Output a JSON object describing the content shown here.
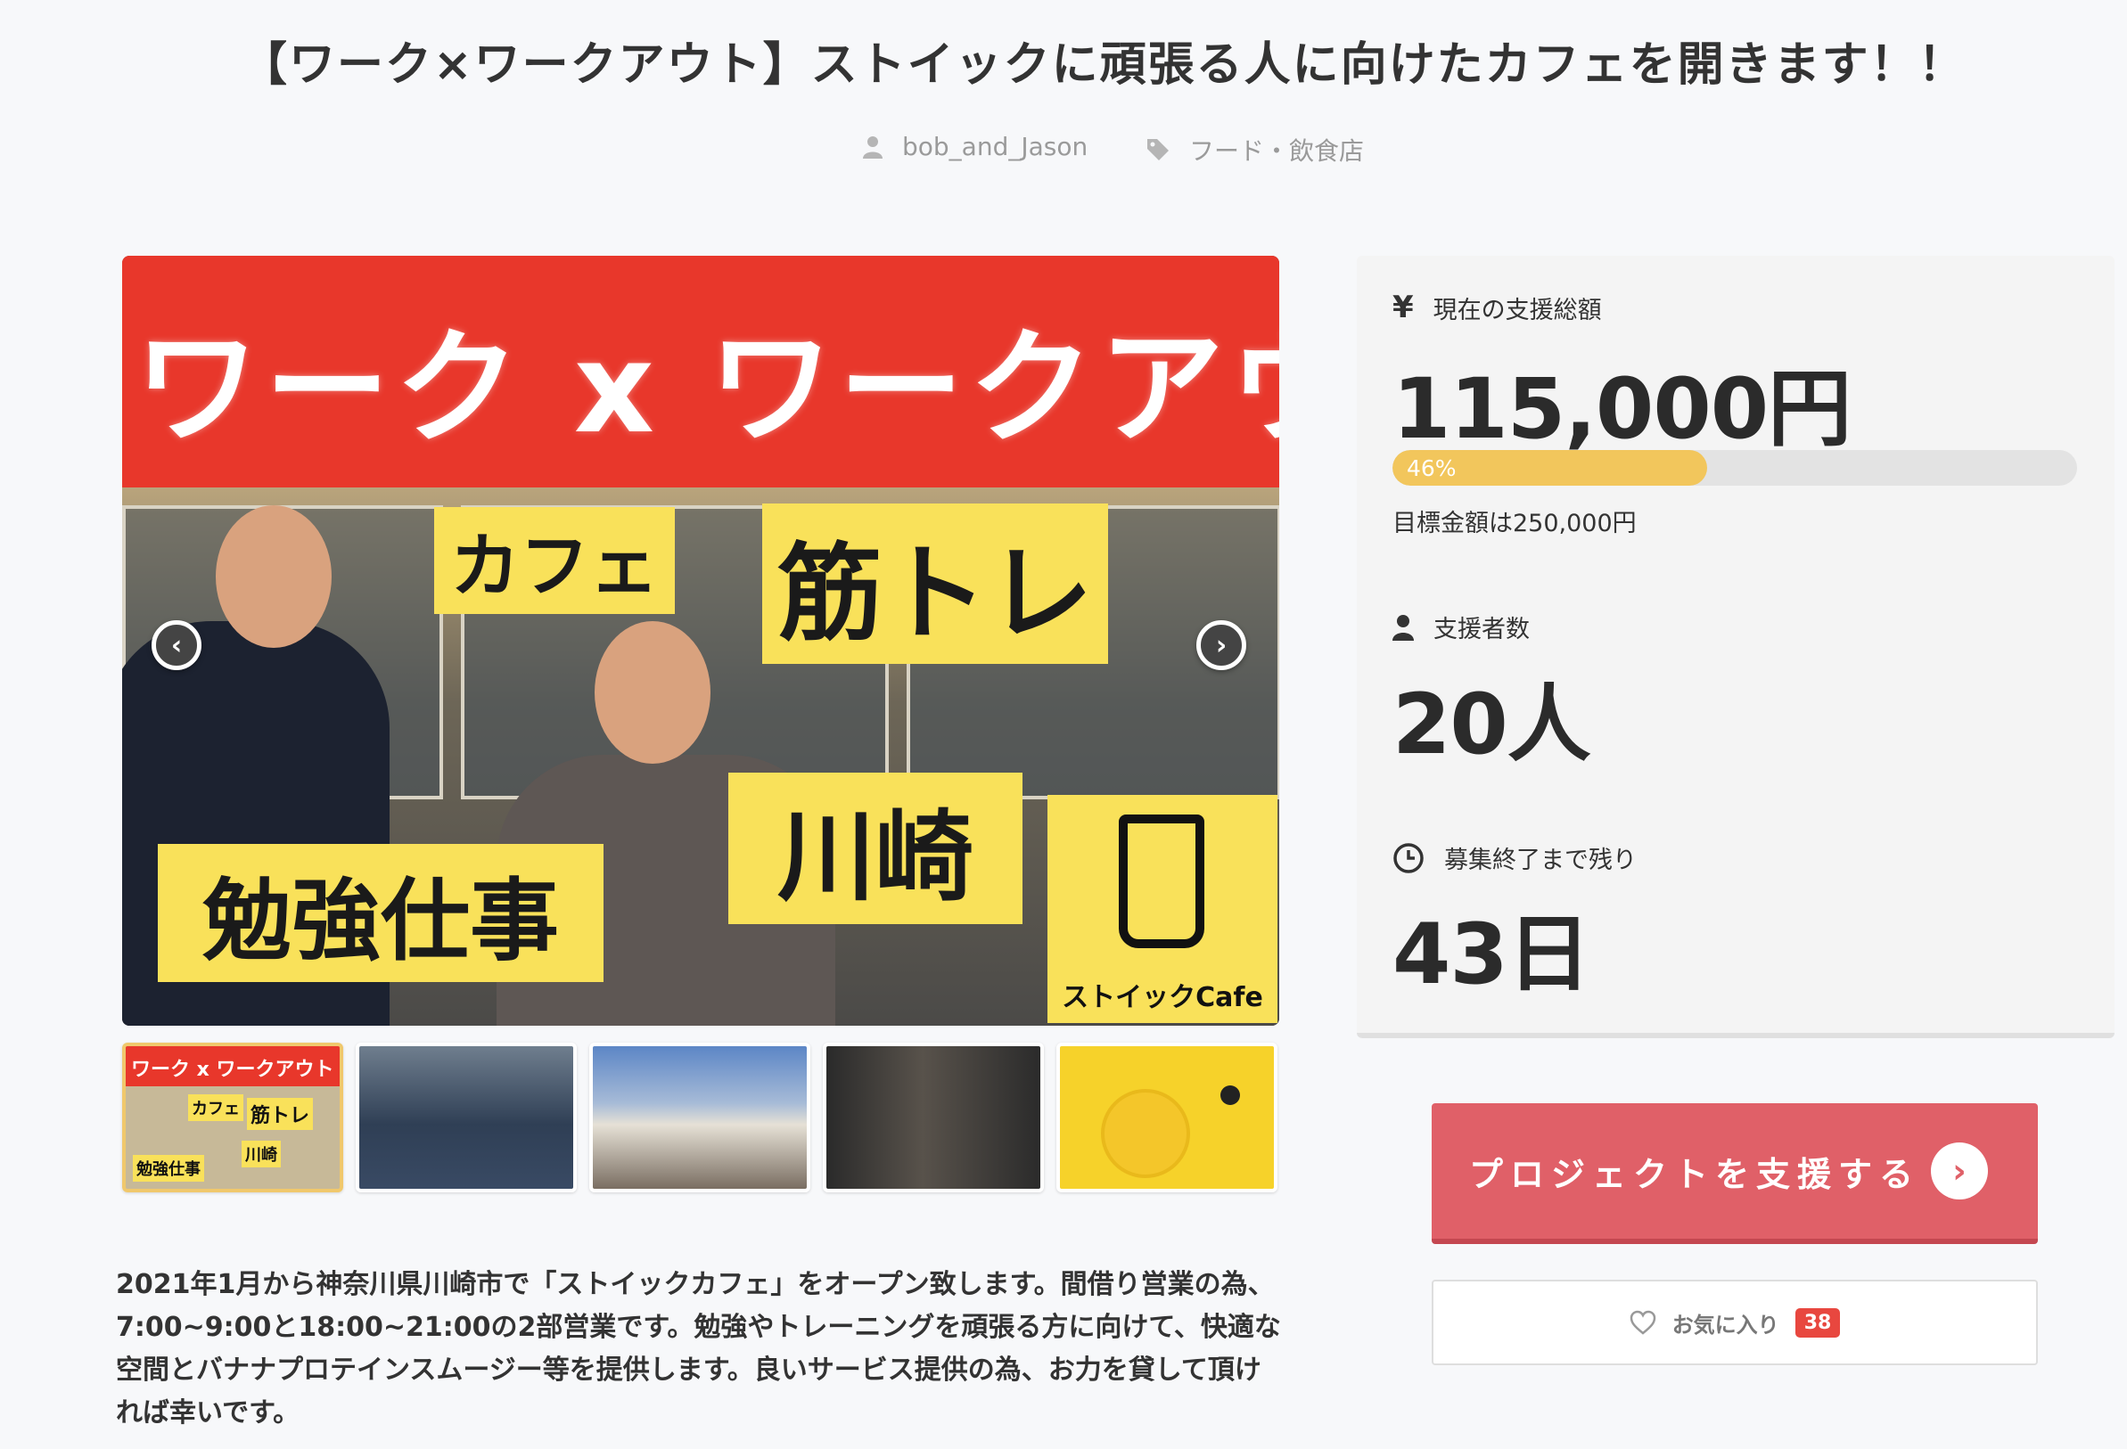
{
  "project": {
    "title": "【ワーク×ワークアウト】ストイックに頑張る人に向けたカフェを開きます！！",
    "author": "bob_and_Jason",
    "category": "フード・飲食店"
  },
  "hero": {
    "banner_text": "ワーク x ワークアウト",
    "tags": {
      "cafe": "カフェ",
      "training": "筋トレ",
      "kawasaki": "川崎",
      "study": "勉強仕事"
    },
    "logo_text": "ストイックCafe",
    "prev_icon": "chevron-left-icon",
    "next_icon": "chevron-right-icon"
  },
  "thumbnails": {
    "t1_title": "ワーク x ワークアウト",
    "t1_cafe": "カフェ",
    "t1_training": "筋トレ",
    "t1_kawasaki": "川崎",
    "t1_study": "勉強仕事"
  },
  "description": "2021年1月から神奈川県川崎市で「ストイックカフェ」をオープン致します。間借り営業の為、7:00~9:00と18:00~21:00の2部営業です。勉強やトレーニングを頑張る方に向けて、快適な空間とバナナプロテインスムージー等を提供します。良いサービス提供の為、お力を貸して頂ければ幸いです。",
  "stats": {
    "funding_label": "現在の支援総額",
    "funding_amount": "115,000円",
    "progress_label": "46%",
    "progress_value": 0.46,
    "goal_text": "目標金額は250,000円",
    "backers_label": "支援者数",
    "backers_count": "20人",
    "remaining_label": "募集終了まで残り",
    "remaining_days": "43日",
    "yen_symbol": "¥"
  },
  "actions": {
    "support_label": "プロジェクトを支援する",
    "favorite_label": "お気に入り",
    "favorite_count": "38"
  },
  "colors": {
    "accent_red": "#e06068",
    "progress_yellow": "#f2c65c",
    "badge_red": "#e8473f"
  }
}
